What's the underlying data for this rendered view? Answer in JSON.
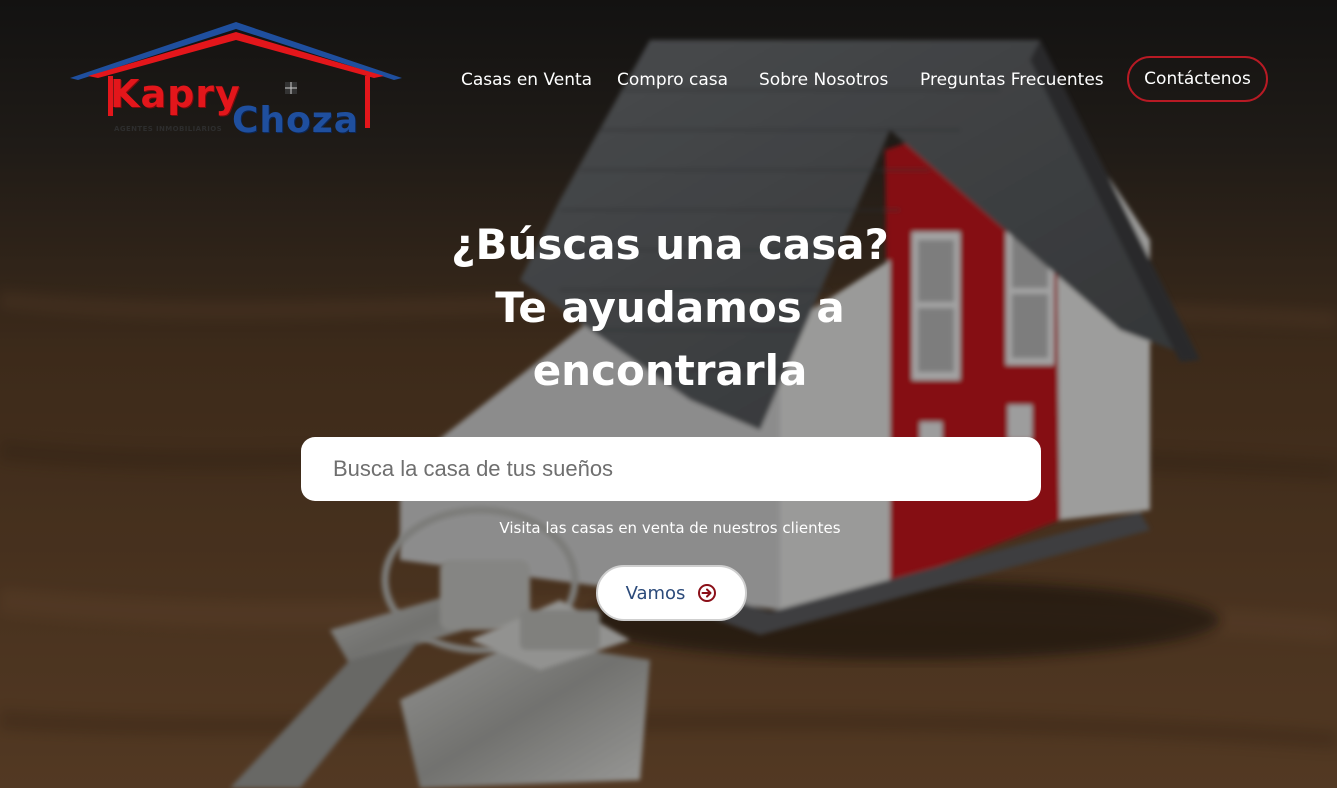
{
  "brand": {
    "name_part1": "Kapry",
    "name_part2": "Choza",
    "tagline": "AGENTES INMOBILIARIOS",
    "colors": {
      "red": "#e3161b",
      "blue": "#1f4f9e"
    }
  },
  "nav": {
    "items": [
      {
        "label": "Casas en Venta"
      },
      {
        "label": "Compro casa"
      },
      {
        "label": "Sobre Nosotros"
      },
      {
        "label": "Preguntas Frecuentes"
      }
    ],
    "contact_label": "Contáctenos"
  },
  "hero": {
    "title_lines": [
      "¿Búscas una casa?",
      "Te ayudamos a",
      "encontrarla"
    ],
    "search_placeholder": "Busca la casa de tus sueños",
    "subtitle": "Visita las casas en venta de nuestros clientes",
    "button_label": "Vamos",
    "button_icon": "arrow-circle-right-icon"
  },
  "colors": {
    "accent": "#b81a24",
    "button_text": "#2b4a7a",
    "icon": "#8b0f18"
  }
}
